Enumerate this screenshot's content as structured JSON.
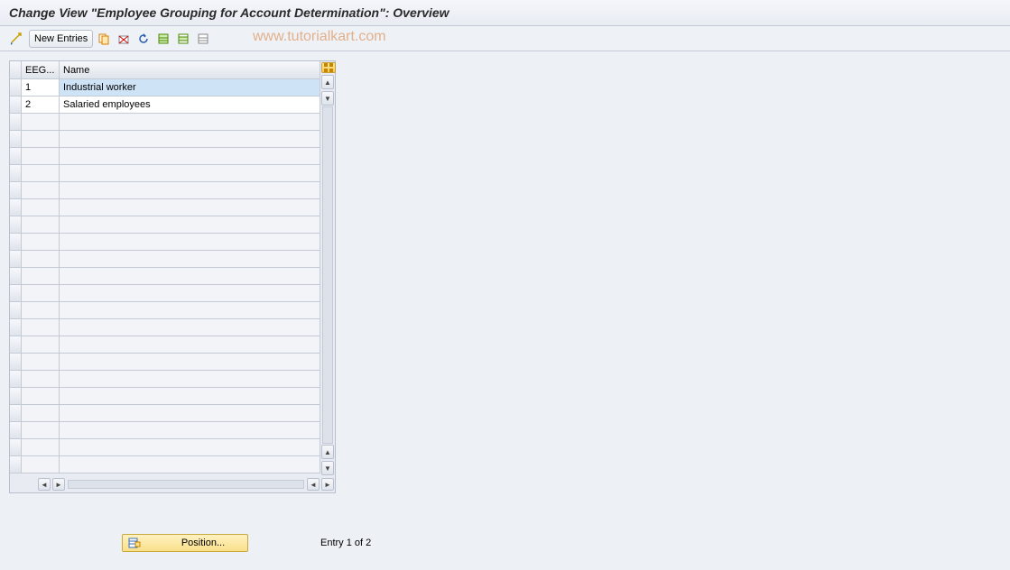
{
  "page_title": "Change View \"Employee Grouping for Account Determination\": Overview",
  "watermark": "www.tutorialkart.com",
  "toolbar": {
    "new_entries_label": "New Entries"
  },
  "table": {
    "columns": {
      "eeg": "EEG...",
      "name": "Name"
    },
    "rows": [
      {
        "eeg": "1",
        "name": "Industrial worker",
        "selected": true
      },
      {
        "eeg": "2",
        "name": "Salaried employees",
        "selected": false
      }
    ],
    "empty_row_count": 21
  },
  "footer": {
    "position_label": "Position...",
    "entry_status": "Entry 1 of 2"
  }
}
